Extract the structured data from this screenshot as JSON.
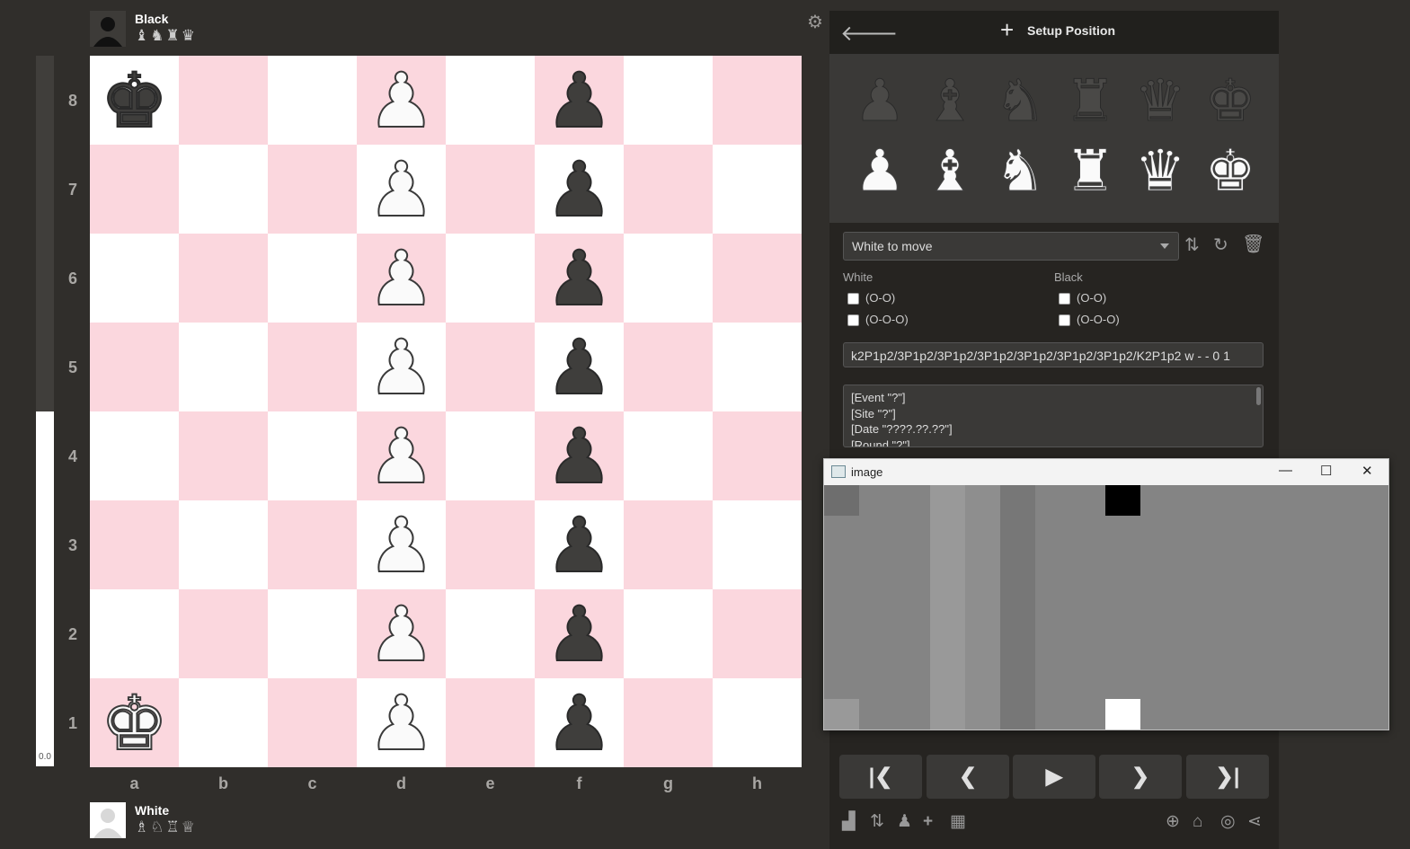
{
  "players": {
    "top": {
      "name": "Black",
      "captured": "♝♞♜♛"
    },
    "bottom": {
      "name": "White",
      "captured": "♗♘♖♕"
    }
  },
  "eval": {
    "label": "0.0",
    "white_fraction": 0.5
  },
  "board": {
    "files": [
      "a",
      "b",
      "c",
      "d",
      "e",
      "f",
      "g",
      "h"
    ],
    "ranks": [
      "8",
      "7",
      "6",
      "5",
      "4",
      "3",
      "2",
      "1"
    ],
    "rows": [
      [
        "bk",
        "",
        "",
        "wp",
        "",
        "bp",
        "",
        ""
      ],
      [
        "",
        "",
        "",
        "wp",
        "",
        "bp",
        "",
        ""
      ],
      [
        "",
        "",
        "",
        "wp",
        "",
        "bp",
        "",
        ""
      ],
      [
        "",
        "",
        "",
        "wp",
        "",
        "bp",
        "",
        ""
      ],
      [
        "",
        "",
        "",
        "wp",
        "",
        "bp",
        "",
        ""
      ],
      [
        "",
        "",
        "",
        "wp",
        "",
        "bp",
        "",
        ""
      ],
      [
        "",
        "",
        "",
        "wp",
        "",
        "bp",
        "",
        ""
      ],
      [
        "wk",
        "",
        "",
        "wp",
        "",
        "bp",
        "",
        ""
      ]
    ]
  },
  "panel": {
    "back_icon": "back-arrow-icon",
    "title": "Setup Position",
    "palette": {
      "black": [
        "bp",
        "bb",
        "bn",
        "br",
        "bq",
        "bk"
      ],
      "white": [
        "wp",
        "wb",
        "wn",
        "wr",
        "wq",
        "wk"
      ]
    },
    "turn_select": {
      "value": "White to move"
    },
    "castling": {
      "white_label": "White",
      "black_label": "Black",
      "short": "(O-O)",
      "long": "(O-O-O)"
    },
    "fen": "k2P1p2/3P1p2/3P1p2/3P1p2/3P1p2/3P1p2/3P1p2/K2P1p2 w - - 0 1",
    "pgn_lines": [
      "[Event \"?\"]",
      "[Site \"?\"]",
      "[Date \"????.??.??\"]",
      "[Round \"?\"]"
    ],
    "nav_buttons": [
      "first",
      "prev",
      "play",
      "next",
      "last"
    ],
    "bottom_icons_left": [
      "bar-chart-icon",
      "flip-icon",
      "pawn-icon",
      "plus-icon",
      "board-edit-icon"
    ],
    "bottom_icons_right": [
      "zoom-icon",
      "library-icon",
      "target-icon",
      "share-icon"
    ]
  },
  "image_window": {
    "title": "image",
    "colors": {
      "base": "#848484",
      "light": "#999999",
      "mid": "#8e8e8e",
      "dark": "#777777",
      "black": "#000000",
      "white": "#ffffff"
    }
  }
}
